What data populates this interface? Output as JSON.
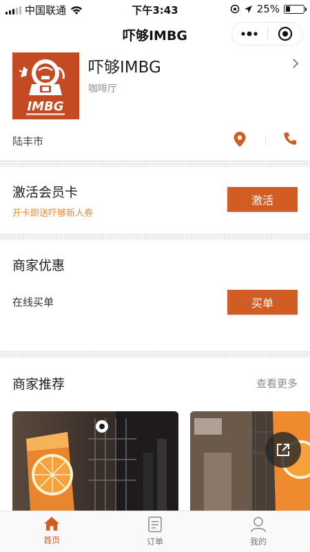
{
  "status_bar": {
    "carrier": "中国联通",
    "time": "下午3:43",
    "battery": "25%",
    "battery_level": 0.25
  },
  "nav": {
    "title": "吓够IMBG",
    "more_icon": "ellipsis-icon",
    "close_icon": "target-circle-icon"
  },
  "store": {
    "name": "吓够IMBG",
    "category": "咖啡厅",
    "logo_text": "IMBG",
    "city": "陆丰市",
    "icons": {
      "location": "map-pin-icon",
      "phone": "phone-icon",
      "chevron": "chevron-right-icon"
    }
  },
  "member": {
    "title": "激活会员卡",
    "subtitle": "开卡即送吓够新人券",
    "button": "激活"
  },
  "deals": {
    "title": "商家优惠",
    "item_label": "在线买单",
    "button": "买单"
  },
  "recommend": {
    "title": "商家推荐",
    "more": "查看更多"
  },
  "tabs": [
    {
      "label": "首页",
      "icon": "home-icon",
      "active": true
    },
    {
      "label": "订单",
      "icon": "order-list-icon",
      "active": false
    },
    {
      "label": "我的",
      "icon": "user-icon",
      "active": false
    }
  ],
  "colors": {
    "accent": "#d25d24",
    "highlight_text": "#e58a2d",
    "logo_bg": "#c44a24"
  }
}
